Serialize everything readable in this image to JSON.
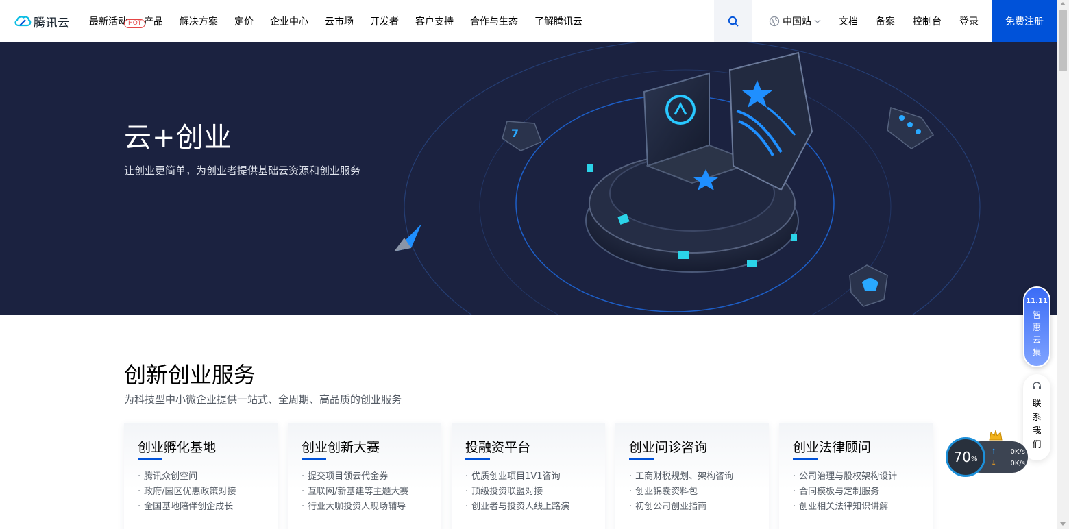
{
  "header": {
    "logo_text": "腾讯云",
    "nav": [
      {
        "label": "最新活动",
        "badge": "HOT"
      },
      {
        "label": "产品"
      },
      {
        "label": "解决方案"
      },
      {
        "label": "定价"
      },
      {
        "label": "企业中心"
      },
      {
        "label": "云市场"
      },
      {
        "label": "开发者"
      },
      {
        "label": "客户支持"
      },
      {
        "label": "合作与生态"
      },
      {
        "label": "了解腾讯云"
      }
    ],
    "search_icon": "search-icon",
    "region": "中国站",
    "right_links": [
      "文档",
      "备案",
      "控制台",
      "登录"
    ],
    "register": "免费注册"
  },
  "hero": {
    "title": "云+创业",
    "subtitle": "让创业更简单，为创业者提供基础云资源和创业服务"
  },
  "services": {
    "title": "创新创业服务",
    "subtitle": "为科技型中小微企业提供一站式、全周期、高品质的创业服务",
    "cards": [
      {
        "title": "创业孵化基地",
        "items": [
          "腾讯众创空间",
          "政府/园区优惠政策对接",
          "全国基地陪伴创企成长"
        ]
      },
      {
        "title": "创业创新大赛",
        "items": [
          "提交项目领云代金券",
          "互联网/新基建等主题大赛",
          "行业大咖投资人现场辅导"
        ]
      },
      {
        "title": "投融资平台",
        "items": [
          "优质创业项目1V1咨询",
          "顶级投资联盟对接",
          "创业者与投资人线上路演"
        ]
      },
      {
        "title": "创业问诊咨询",
        "items": [
          "工商财税规划、架构咨询",
          "创业锦囊资料包",
          "初创公司创业指南"
        ]
      },
      {
        "title": "创业法律顾问",
        "items": [
          "公司治理与股权架构设计",
          "合同模板与定制服务",
          "创业相关法律知识讲解"
        ]
      }
    ]
  },
  "floating": {
    "promo_top": "11.11",
    "promo_chars": [
      "智",
      "惠",
      "云",
      "集"
    ],
    "contact_chars": [
      "联",
      "系",
      "我",
      "们"
    ],
    "speed_percent": "70",
    "speed_unit": "%",
    "upload": "0K/s",
    "download": "0K/s"
  },
  "colors": {
    "brand_blue": "#0052d9",
    "hero_bg": "#1b2240",
    "hot_red": "#e54545"
  }
}
